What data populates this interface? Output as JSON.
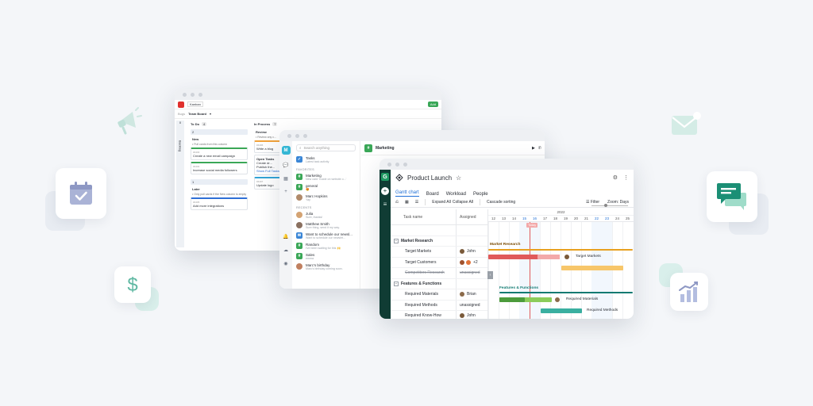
{
  "colors": {
    "brand_green": "#1f9a62",
    "gantt_rail": "#103c34",
    "tab_blue": "#1f6fd6",
    "market_bar": "#e8a020",
    "features_bar": "#107a72",
    "red_bar": "#e05a5a",
    "orange_bar": "#f7c66a",
    "green_bar": "#4c9b3c",
    "teal_bar": "#3aafa0"
  },
  "decorations": {
    "icons": [
      "calendar-check-icon",
      "dollar-icon",
      "megaphone-icon",
      "envelope-icon",
      "chat-bubbles-icon",
      "bar-chart-icon"
    ]
  },
  "board": {
    "app_name": "Team Board",
    "workspace": "Bugs",
    "view_label": "Kanban",
    "add_label": "Add",
    "side_label": "Backlog",
    "side_count": "0",
    "columns": [
      {
        "title": "To Do",
        "count": "4",
        "lanes": [
          {
            "count": "2",
            "sub": "New",
            "note": "• Pull cards from this column",
            "cards": [
              {
                "ref": "#4403",
                "text": "Create a new email campaign",
                "style": "green"
              },
              {
                "ref": "#4404",
                "text": "Increase social media followers",
                "style": "green"
              }
            ]
          },
          {
            "count": "1",
            "sub": "Later",
            "note": "• Only pull cards if the New column is empty",
            "cards": [
              {
                "ref": "#4405",
                "text": "Add more integrations",
                "style": "blue"
              }
            ]
          }
        ]
      },
      {
        "title": "In Process",
        "count": "7",
        "lanes": [
          {
            "count": "",
            "sub": "Review",
            "note": "• Review any c...",
            "cards": [
              {
                "ref": "#4406",
                "text": "Write a blog",
                "style": "orange"
              },
              {
                "ref": "",
                "text": "Open Tasks",
                "style": ""
              },
              {
                "ref": "#4407",
                "text": "Update logo",
                "style": "teal"
              }
            ]
          }
        ]
      }
    ],
    "open_tasks": [
      "Create dr...",
      "Publish the...",
      "Show Full Tasks"
    ]
  },
  "chat": {
    "brand_letter": "M",
    "search_placeholder": "Search anything",
    "channel_title": "Marketing",
    "items_top": [
      {
        "name": "Tasks",
        "preview": "Latest task activity"
      }
    ],
    "favorites_label": "FAVORITES",
    "favorites": [
      {
        "name": "Marketing",
        "preview": "New card 'Guide on website o...'"
      },
      {
        "name": "general",
        "preview": "😍"
      },
      {
        "name": "Marc Hopkins",
        "preview": "Yay"
      }
    ],
    "recents_label": "RECENTS",
    "recents": [
      {
        "name": "Julia",
        "preview": "Sure, thanks!"
      },
      {
        "name": "Matthew Smith",
        "preview": "Sure thing, send it my way."
      },
      {
        "name": "Want to schedule our newsl...",
        "preview": "Want to schedule our newslet..."
      },
      {
        "name": "Random",
        "preview": "I've been waiting for this 🙌"
      },
      {
        "name": "Sales",
        "preview": "emma"
      },
      {
        "name": "Marc's birthday",
        "preview": "Marc's birthday coming soon."
      }
    ]
  },
  "gantt": {
    "logo_letter": "G",
    "project_title": "Product Launch",
    "tabs": [
      "Gantt chart",
      "Board",
      "Workload",
      "People"
    ],
    "tools": {
      "expand": "Expand All",
      "collapse": "Collapse All",
      "cascade": "Cascade sorting",
      "filter": "Filter",
      "zoom": "Zoom: Days"
    },
    "col_task": "Task name",
    "col_assigned": "Assigned",
    "rows": [
      {
        "kind": "spacer",
        "name": "",
        "assigned": ""
      },
      {
        "kind": "group",
        "name": "Market Research",
        "assigned": ""
      },
      {
        "kind": "task",
        "name": "Target Markets",
        "assigned": "John",
        "avatar": "#7a5a3a"
      },
      {
        "kind": "task",
        "name": "Target Customers",
        "assigned": "+2",
        "avatar": "#a0522d"
      },
      {
        "kind": "done",
        "name": "Competitors Research",
        "assigned": "unassigned"
      },
      {
        "kind": "group",
        "name": "Features & Functions",
        "assigned": ""
      },
      {
        "kind": "task",
        "name": "Required Materials",
        "assigned": "Brian",
        "avatar": "#8b6a4a"
      },
      {
        "kind": "task",
        "name": "Required Methods",
        "assigned": "unassigned"
      },
      {
        "kind": "task",
        "name": "Required Know-How",
        "assigned": "John",
        "avatar": "#7a5a3a"
      }
    ],
    "year": "2022",
    "days": [
      "12",
      "13",
      "14",
      "15",
      "16",
      "17",
      "18",
      "19",
      "20",
      "21",
      "22",
      "23",
      "24",
      "25"
    ],
    "weekend_days": [
      "15",
      "16",
      "22",
      "23"
    ],
    "today_label": "Today",
    "bar_labels": {
      "market": "Market Research",
      "features": "Features & Functions",
      "target_markets": "Target Markets",
      "required_materials": "Required Materials",
      "required_methods": "Required Methods"
    }
  }
}
